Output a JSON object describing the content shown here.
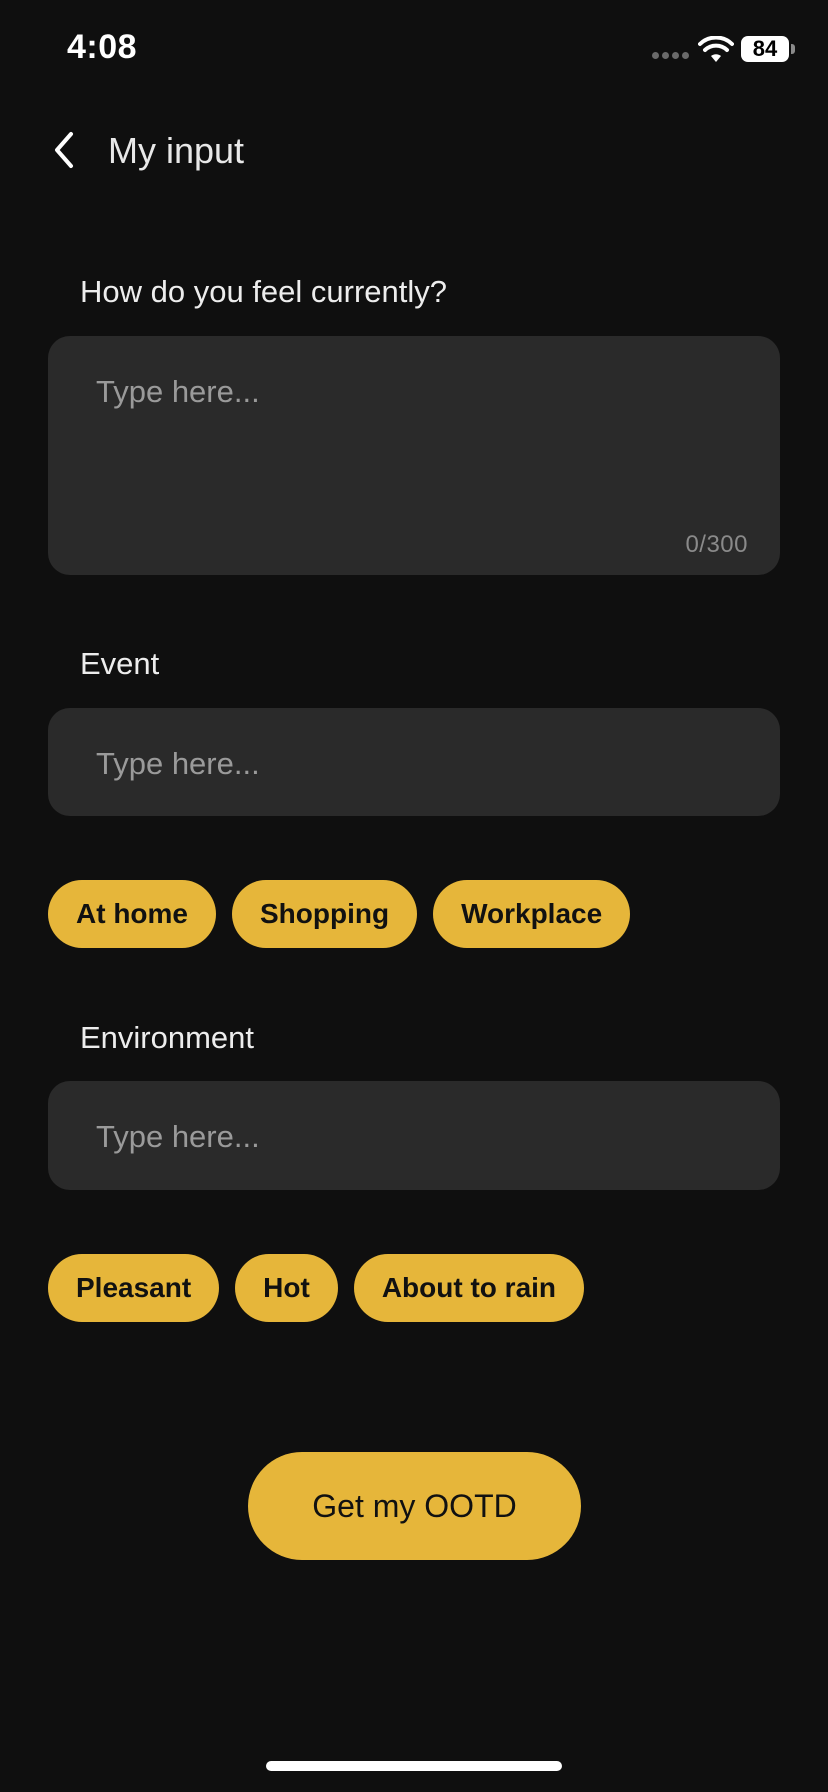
{
  "status_bar": {
    "time": "4:08",
    "battery": "84",
    "icons": [
      "signal-dots-icon",
      "wifi-icon",
      "battery-icon"
    ]
  },
  "header": {
    "back_icon": "chevron-left-icon",
    "title": "My input"
  },
  "feeling": {
    "label": "How do you feel currently?",
    "placeholder": "Type here...",
    "counter": "0/300"
  },
  "event": {
    "label": "Event",
    "placeholder": "Type here...",
    "chips": [
      "At home",
      "Shopping",
      "Workplace"
    ]
  },
  "environment": {
    "label": "Environment",
    "placeholder": "Type here...",
    "chips": [
      "Pleasant",
      "Hot",
      "About to rain"
    ]
  },
  "cta": {
    "label": "Get my OOTD"
  },
  "colors": {
    "background": "#0f0f0f",
    "field": "#2a2a2a",
    "accent": "#e6b63a"
  }
}
